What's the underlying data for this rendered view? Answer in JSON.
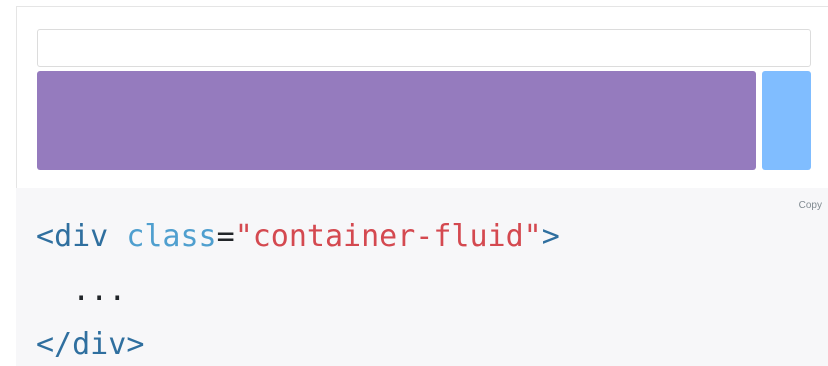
{
  "example": {
    "colors": {
      "container_border": "#dcdcdc",
      "purple_block": "#957bbe",
      "blue_block": "#80bdff"
    }
  },
  "code": {
    "copy_label": "Copy",
    "line1": {
      "open_bracket": "<",
      "tag": "div",
      "attr": "class",
      "equals": "=",
      "value": "\"container-fluid\"",
      "close_bracket": ">"
    },
    "line2": "  ...",
    "line3": {
      "open_bracket": "</",
      "tag": "div",
      "close_bracket": ">"
    },
    "colors": {
      "background": "#f7f7f9",
      "tag": "#2f6f9f",
      "attr": "#4f9fcf",
      "value": "#d44950"
    }
  }
}
